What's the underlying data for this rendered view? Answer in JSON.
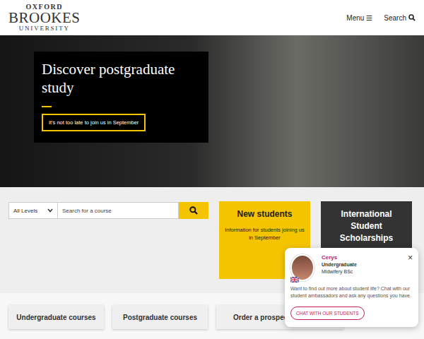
{
  "logo": {
    "lines": [
      "OXFORD",
      "BROOKES",
      "UNIVERSITY"
    ]
  },
  "header": {
    "menu": {
      "label": "Menu",
      "icon": "☰"
    },
    "search": {
      "label": "Search"
    }
  },
  "hero": {
    "title": "Discover postgraduate study",
    "button": "It's not too late to join us in September"
  },
  "course_search": {
    "level": "All Levels",
    "placeholder": "Search for a course"
  },
  "cards": [
    {
      "kind": "yellow",
      "title": "New students",
      "text": "Information for students joining us in September"
    },
    {
      "kind": "dark",
      "title": "International Student Scholarships"
    }
  ],
  "quick_links": [
    "Undergraduate courses",
    "Postgraduate courses",
    "Order a prospec"
  ],
  "chat": {
    "name": "Cerys",
    "level": "Undergraduate",
    "course": "Midwifery BSc",
    "close": "×",
    "message": "Want to find out more about student life? Chat with our student ambassadors and ask any questions you have.",
    "button": "CHAT WITH OUR STUDENTS"
  }
}
